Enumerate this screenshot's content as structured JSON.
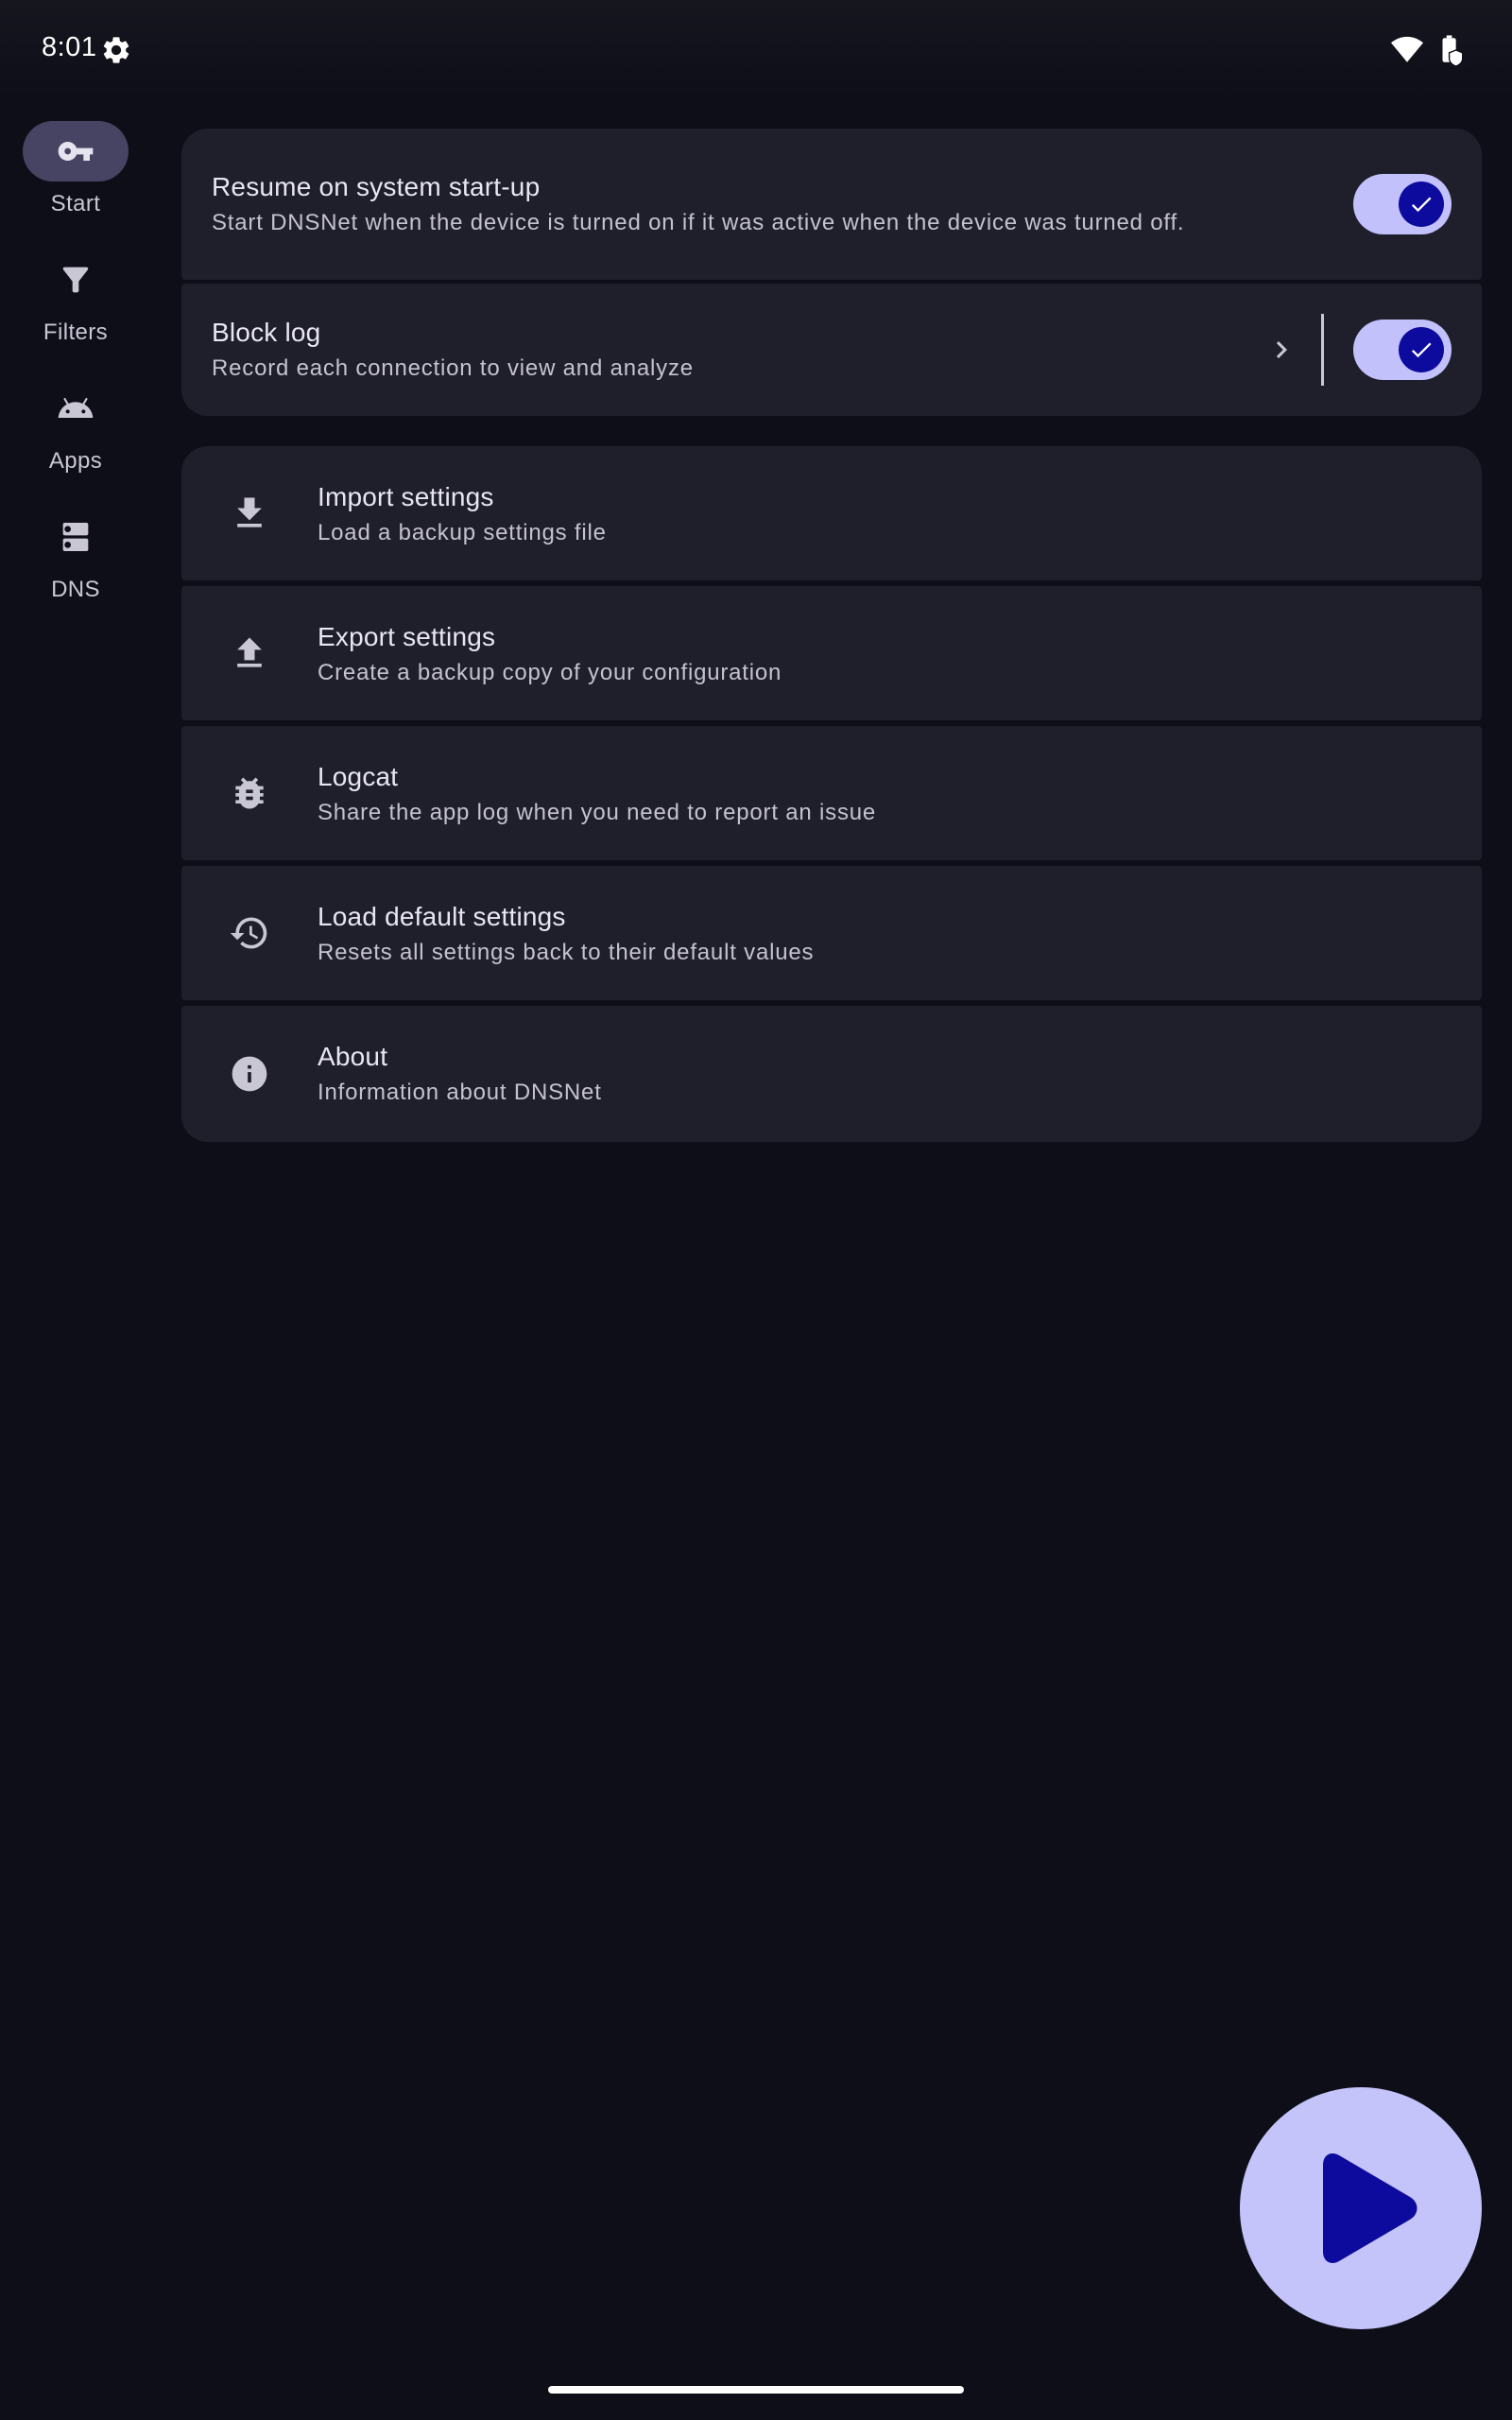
{
  "status_bar": {
    "time": "8:01",
    "icons": [
      "settings-icon",
      "wifi-icon",
      "battery-icon"
    ]
  },
  "nav": {
    "items": [
      {
        "label": "Start",
        "icon": "key-icon",
        "active": true
      },
      {
        "label": "Filters",
        "icon": "filter-icon",
        "active": false
      },
      {
        "label": "Apps",
        "icon": "android-icon",
        "active": false
      },
      {
        "label": "DNS",
        "icon": "server-icon",
        "active": false
      }
    ]
  },
  "toggles": {
    "resume": {
      "title": "Resume on system start-up",
      "subtitle": "Start DNSNet when the device is turned on if it was active when the device was turned off.",
      "checked": true
    },
    "block_log": {
      "title": "Block log",
      "subtitle": "Record each connection to view and analyze",
      "checked": true
    }
  },
  "actions": [
    {
      "title": "Import settings",
      "subtitle": "Load a backup settings file",
      "icon": "download-icon"
    },
    {
      "title": "Export settings",
      "subtitle": "Create a backup copy of your configuration",
      "icon": "upload-icon"
    },
    {
      "title": "Logcat",
      "subtitle": "Share the app log when you need to report an issue",
      "icon": "bug-icon"
    },
    {
      "title": "Load default settings",
      "subtitle": "Resets all settings back to their default values",
      "icon": "history-icon"
    },
    {
      "title": "About",
      "subtitle": "Information about DNSNet",
      "icon": "info-icon"
    }
  ],
  "fab": {
    "icon": "play-icon"
  },
  "colors": {
    "background": "#0e0e19",
    "card": "#1f1f2b",
    "accent": "#c2c1fb",
    "accent_dark": "#0d0b9d",
    "nav_active": "#474463"
  }
}
